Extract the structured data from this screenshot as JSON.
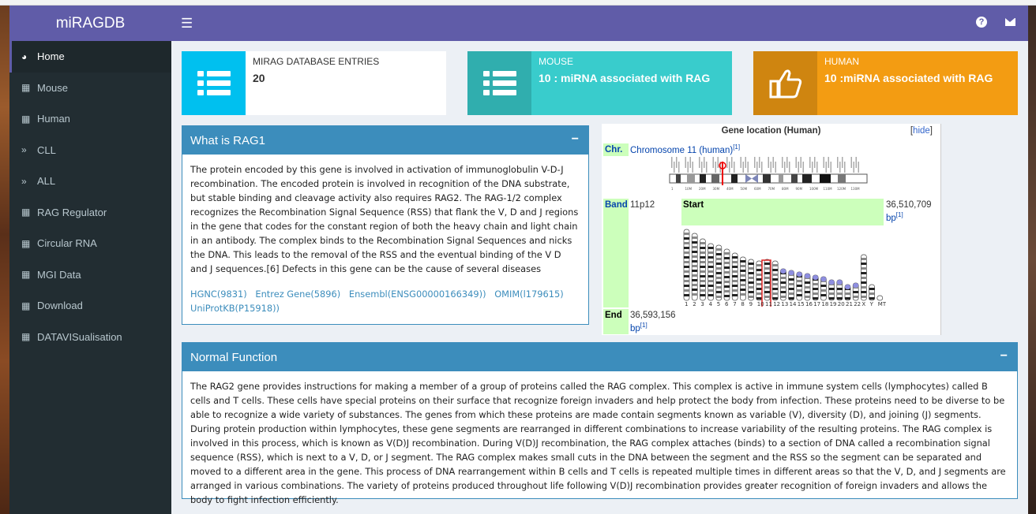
{
  "app": {
    "title": "miRAGDB"
  },
  "sidebar": {
    "items": [
      {
        "label": "Home",
        "icon": "dashboard-icon"
      },
      {
        "label": "Mouse",
        "icon": "grid-icon"
      },
      {
        "label": "Human",
        "icon": "grid-icon"
      },
      {
        "label": "CLL",
        "icon": "chevrons-right-icon"
      },
      {
        "label": "ALL",
        "icon": "chevrons-right-icon"
      },
      {
        "label": "RAG Regulator",
        "icon": "grid-icon"
      },
      {
        "label": "Circular RNA",
        "icon": "grid-icon"
      },
      {
        "label": "MGI Data",
        "icon": "grid-icon"
      },
      {
        "label": "Download",
        "icon": "grid-icon"
      },
      {
        "label": "DATAVISualisation",
        "icon": "grid-icon"
      }
    ]
  },
  "header": {
    "menu_icon": "hamburger-icon",
    "help_icon": "question-icon",
    "mail_icon": "envelope-icon"
  },
  "infoboxes": [
    {
      "label": "MIRAG DATABASE ENTRIES",
      "value": "20",
      "icon": "list-icon",
      "color": "#00c0ef"
    },
    {
      "label": "MOUSE",
      "value": "10 : miRNA associated with RAG",
      "icon": "list-icon",
      "color": "#39cccc"
    },
    {
      "label": "HUMAN",
      "value": "10 :miRNA associated with RAG",
      "icon": "thumbs-up-icon",
      "color": "#f39c12"
    }
  ],
  "rag1": {
    "title": "What is RAG1",
    "text": "The protein encoded by this gene is involved in activation of immunoglobulin V-D-J recombination. The encoded protein is involved in recognition of the DNA substrate, but stable binding and cleavage activity also requires RAG2. The RAG-1/2 complex recognizes the Recombination Signal Sequence (RSS) that flank the V, D and J regions in the gene that codes for the constant region of both the heavy chain and light chain in an antibody. The complex binds to the Recombination Signal Sequences and nicks the DNA. This leads to the removal of the RSS and the eventual binding of the V D and J sequences.[6] Defects in this gene can be the cause of several diseases",
    "links": [
      "HGNC(9831)",
      "Entrez Gene(5896)",
      "Ensembl(ENSG00000166349))",
      "OMIM(l179615)",
      "UniProtKB(P15918))"
    ]
  },
  "gene_location": {
    "title": "Gene location (Human)",
    "hide_label": "hide",
    "chr_label": "Chr.",
    "chr_value": "Chromosome 11 (human)",
    "ref": "[1]",
    "band_label": "Band",
    "band_value": "11p12",
    "start_label": "Start",
    "start_value": "36,510,709",
    "end_label": "End",
    "end_value": "36,593,156",
    "bp": "bp",
    "scale_labels": [
      "1",
      "10M",
      "20M",
      "30M",
      "40M",
      "50M",
      "60M",
      "70M",
      "80M",
      "90M",
      "100M",
      "110M",
      "120M",
      "130M"
    ],
    "chromosome_labels": [
      "1",
      "2",
      "3",
      "4",
      "5",
      "6",
      "7",
      "8",
      "9",
      "10",
      "11",
      "12",
      "13",
      "14",
      "15",
      "16",
      "17",
      "18",
      "19",
      "20",
      "21",
      "22",
      "X",
      "Y",
      "MT"
    ]
  },
  "normal_function": {
    "title": "Normal Function",
    "text": "The RAG2 gene provides instructions for making a member of a group of proteins called the RAG complex. This complex is active in immune system cells (lymphocytes) called B cells and T cells. These cells have special proteins on their surface that recognize foreign invaders and help protect the body from infection. These proteins need to be diverse to be able to recognize a wide variety of substances. The genes from which these proteins are made contain segments known as variable (V), diversity (D), and joining (J) segments. During protein production within lymphocytes, these gene segments are rearranged in different combinations to increase variability of the resulting proteins. The RAG complex is involved in this process, which is known as V(D)J recombination. During V(D)J recombination, the RAG complex attaches (binds) to a section of DNA called a recombination signal sequence (RSS), which is next to a V, D, or J segment. The RAG complex makes small cuts in the DNA between the segment and the RSS so the segment can be separated and moved to a different area in the gene. This process of DNA rearrangement within B cells and T cells is repeated multiple times in different areas so that the V, D, and J segments are arranged in various combinations. The variety of proteins produced throughout life following V(D)J recombination provides greater recognition of foreign invaders and allows the body to fight infection efficiently."
  }
}
